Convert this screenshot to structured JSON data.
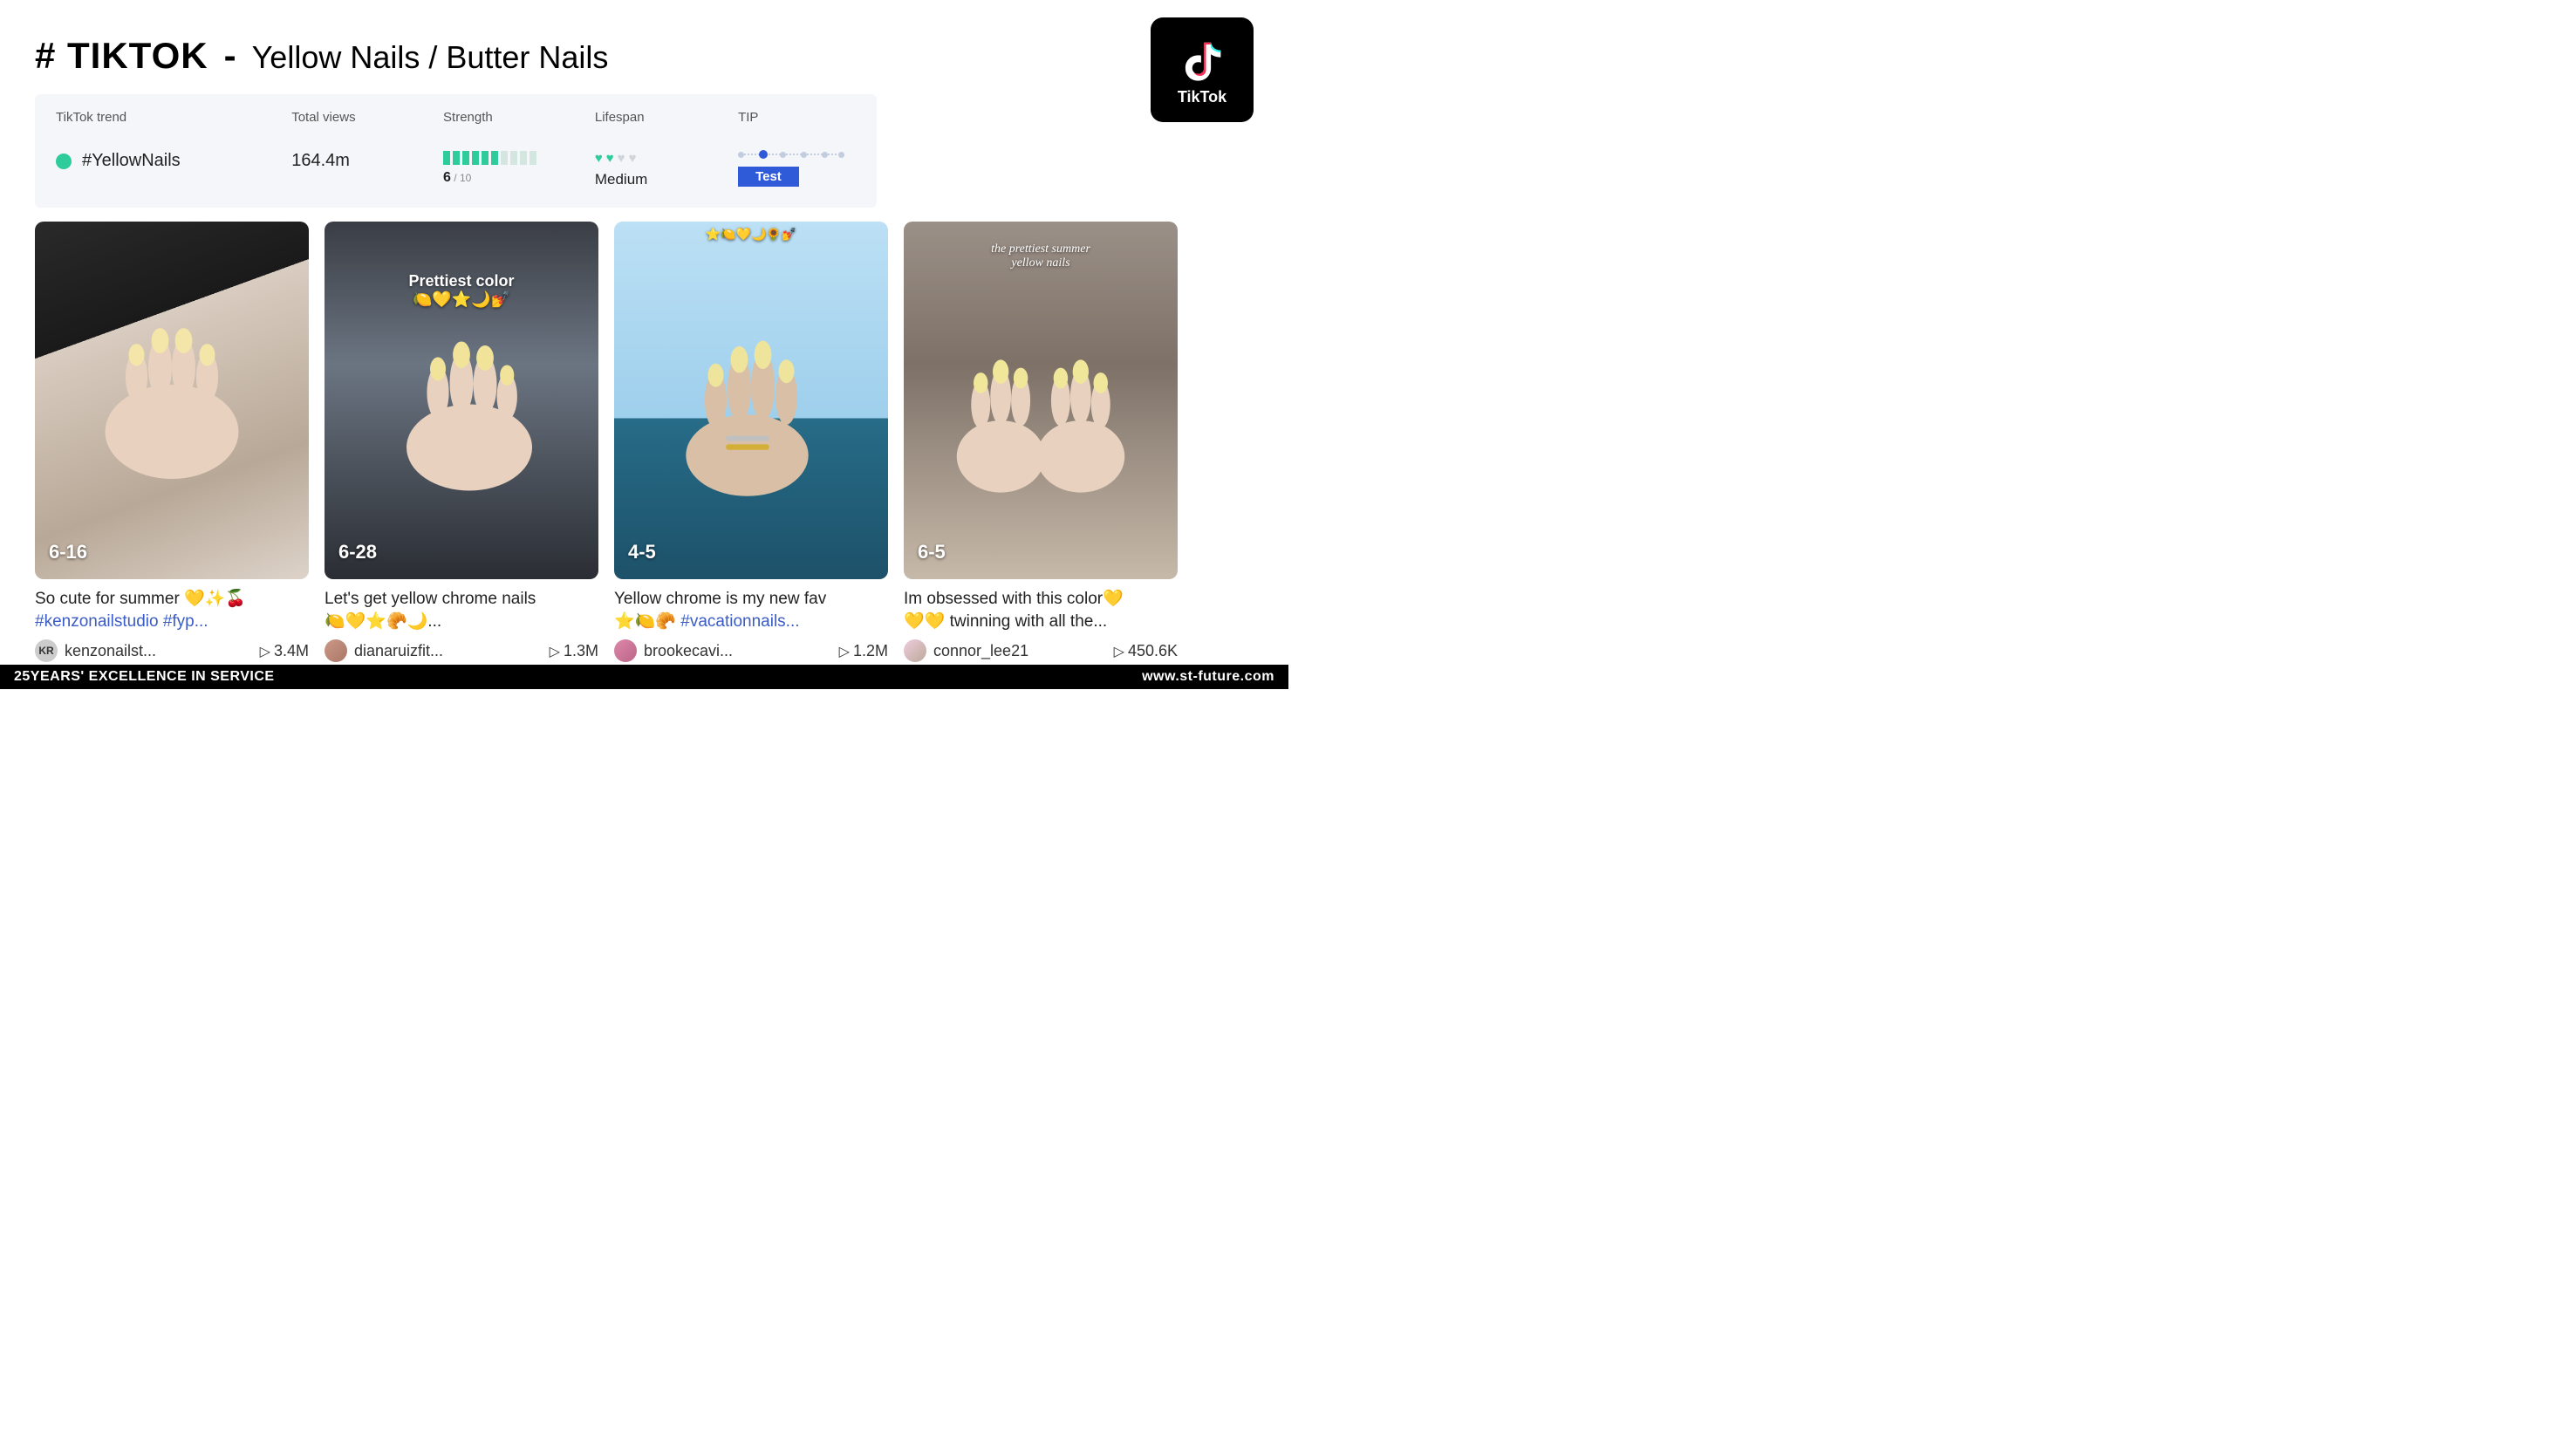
{
  "header": {
    "title_bold": "# TIKTOK",
    "separator": "-",
    "title_sub": "Yellow Nails / Butter Nails",
    "logo_text": "TikTok"
  },
  "stats": {
    "head_trend": "TikTok trend",
    "head_views": "Total views",
    "head_strength": "Strength",
    "head_lifespan": "Lifespan",
    "head_tip": "TIP",
    "trend_name": "#YellowNails",
    "views": "164.4m",
    "strength_num": "6",
    "strength_denom": " / 10",
    "lifespan_text": "Medium",
    "tip_badge": "Test"
  },
  "posts": [
    {
      "date": "6-16",
      "overlay": "",
      "overlay_top": "",
      "caption_text": "So cute for summer 💛✨🍒",
      "caption_tags": "#kenzonailstudio #fyp...",
      "user": "kenzonailst...",
      "avatar_initials": "KR",
      "plays": "3.4M"
    },
    {
      "date": "6-28",
      "overlay": "Prettiest color",
      "overlay_top": "",
      "caption_text": "Let's get yellow chrome nails",
      "caption_tags": "🍋💛⭐🥐🌙...",
      "user": "dianaruizfit...",
      "avatar_initials": "",
      "plays": "1.3M"
    },
    {
      "date": "4-5",
      "overlay": "",
      "overlay_top": "⭐🍋💛🌙🌻💅",
      "caption_text": "Yellow chrome is my new fav",
      "caption_tags": "⭐🍋🥐 #vacationnails...",
      "user": "brookecavi...",
      "avatar_initials": "",
      "plays": "1.2M"
    },
    {
      "date": "6-5",
      "overlay": "",
      "overlay_top": "the prettiest summer\nyellow nails",
      "caption_text": "Im obsessed with this color💛",
      "caption_tags": "💛💛 twinning with all the...",
      "user": "connor_lee21",
      "avatar_initials": "",
      "plays": "450.6K"
    }
  ],
  "footer": {
    "left": "25YEARS' EXCELLENCE IN SERVICE",
    "right": "www.st-future.com"
  }
}
